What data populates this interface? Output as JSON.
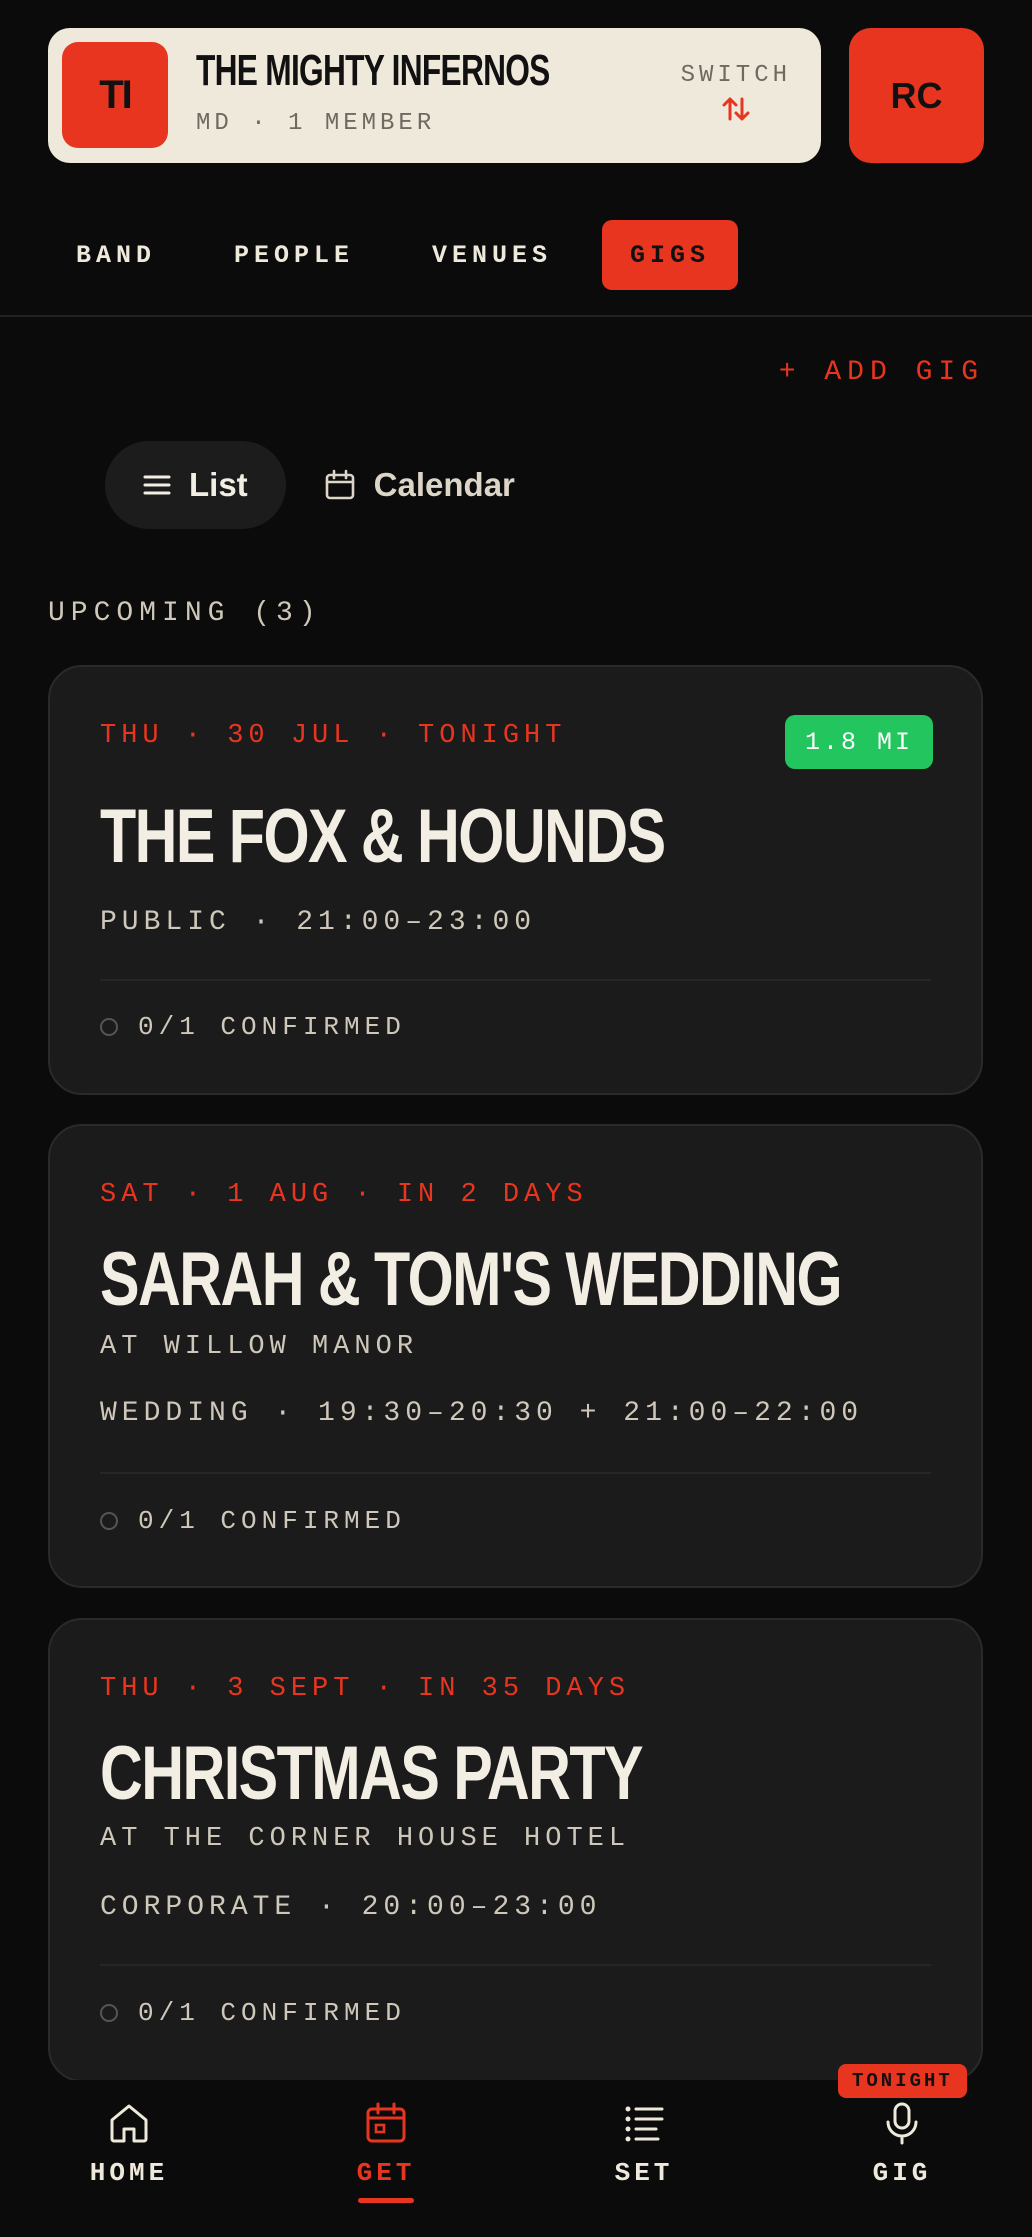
{
  "band": {
    "initials": "TI",
    "name": "THE MIGHTY INFERNOS",
    "subtitle": "MD · 1 MEMBER",
    "switch_label": "SWITCH"
  },
  "user": {
    "initials": "RC"
  },
  "tabs": [
    {
      "label": "BAND",
      "active": false
    },
    {
      "label": "PEOPLE",
      "active": false
    },
    {
      "label": "VENUES",
      "active": false
    },
    {
      "label": "GIGS",
      "active": true
    }
  ],
  "add_gig_label": "+ ADD GIG",
  "view_toggle": {
    "list": "List",
    "calendar": "Calendar",
    "selected": "List"
  },
  "section_title": "UPCOMING (3)",
  "gigs": [
    {
      "date": "THU · 30 JUL · TONIGHT",
      "title": "THE FOX & HOUNDS",
      "venue": "",
      "meta": "PUBLIC · 21:00–23:00",
      "confirmed": "0/1 CONFIRMED",
      "badge": "1.8 MI"
    },
    {
      "date": "SAT · 1 AUG · IN 2 DAYS",
      "title": "SARAH & TOM'S WEDDING",
      "venue": "AT WILLOW MANOR",
      "meta": "WEDDING · 19:30–20:30 + 21:00–22:00",
      "confirmed": "0/1 CONFIRMED"
    },
    {
      "date": "THU · 3 SEPT · IN 35 DAYS",
      "title": "CHRISTMAS PARTY",
      "venue": "AT THE CORNER HOUSE HOTEL",
      "meta": "CORPORATE · 20:00–23:00",
      "confirmed": "0/1 CONFIRMED"
    }
  ],
  "bottom_nav": [
    {
      "label": "HOME",
      "icon": "home-icon",
      "active": false
    },
    {
      "label": "GET",
      "icon": "calendar-icon",
      "active": true
    },
    {
      "label": "SET",
      "icon": "list-icon",
      "active": false
    },
    {
      "label": "GIG",
      "icon": "microphone-icon",
      "active": false
    }
  ],
  "tonight_badge": "TONIGHT",
  "colors": {
    "accent": "#e8351f",
    "background": "#0b0b0b",
    "card": "#1b1b1b",
    "cream": "#efe9dc",
    "success": "#22c55e"
  }
}
